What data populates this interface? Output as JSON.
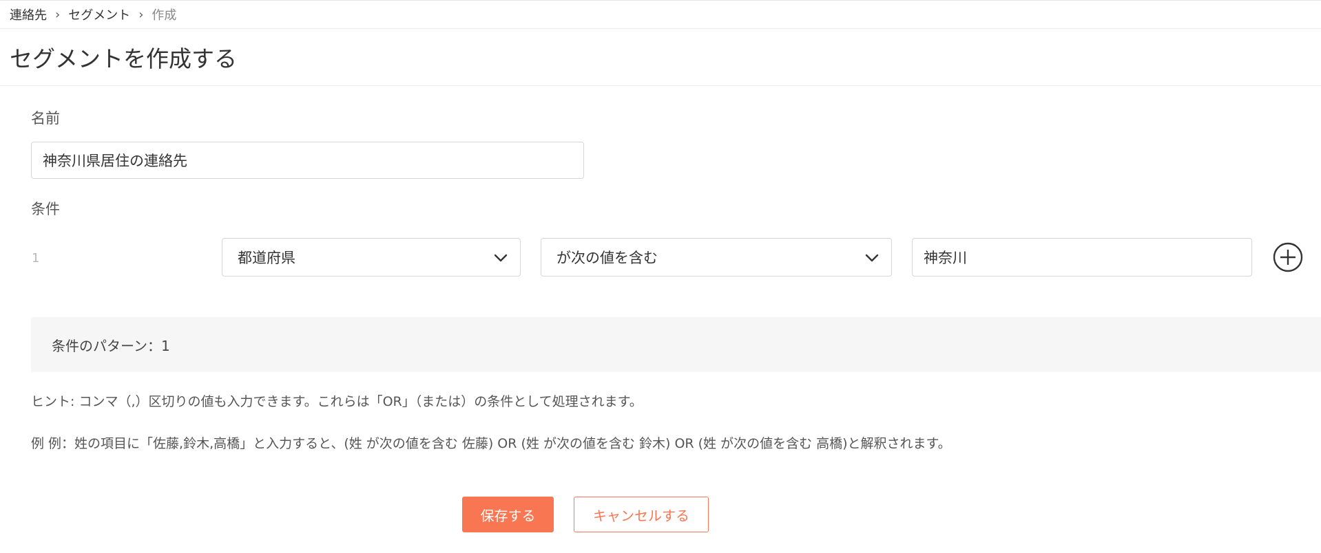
{
  "breadcrumb": {
    "items": [
      "連絡先",
      "セグメント"
    ],
    "current": "作成",
    "separator": "›"
  },
  "page_title": "セグメントを作成する",
  "form": {
    "name_label": "名前",
    "name_value": "神奈川県居住の連絡先",
    "conditions_label": "条件",
    "condition": {
      "index": "1",
      "field": "都道府県",
      "operator": "が次の値を含む",
      "value": "神奈川"
    },
    "pattern_text": "条件のパターン：1",
    "hint": "ヒント: コンマ（,）区切りの値も入力できます。これらは「OR」（または）の条件として処理されます。",
    "example": "例 例：姓の項目に「佐藤,鈴木,高橋」と入力すると、(姓 が次の値を含む 佐藤) OR (姓 が次の値を含む 鈴木) OR (姓 が次の値を含む 高橋)と解釈されます。"
  },
  "buttons": {
    "save": "保存する",
    "cancel": "キャンセルする"
  },
  "icons": {
    "dropdown": "chevron-down-icon",
    "add": "plus-circle-icon"
  },
  "colors": {
    "accent": "#f87752",
    "pattern_bg": "#f6f6f6",
    "border": "#d6d6d6"
  }
}
